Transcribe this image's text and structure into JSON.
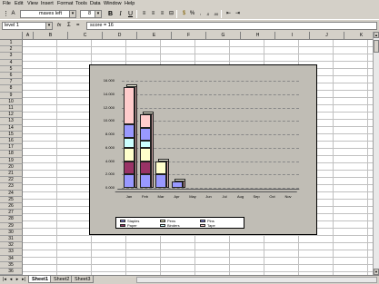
{
  "menu": [
    "File",
    "Edit",
    "View",
    "Insert",
    "Format",
    "Tools",
    "Data",
    "Window",
    "Help"
  ],
  "toolbar": {
    "font_name": "maves left",
    "font_size": "8",
    "bold": "B",
    "italic": "I",
    "underline": "U"
  },
  "formula_bar": {
    "name_box": "level 1",
    "fx": "fx",
    "sigma": "Σ",
    "equals": "=",
    "formula": "score = 16"
  },
  "columns": [
    "A",
    "B",
    "C",
    "D",
    "E",
    "F",
    "G",
    "H",
    "I",
    "J",
    "K"
  ],
  "rows": [
    "1",
    "2",
    "3",
    "4",
    "5",
    "6",
    "7",
    "8",
    "9",
    "10",
    "11",
    "12",
    "13",
    "14",
    "15",
    "16",
    "17",
    "18",
    "19",
    "20",
    "21",
    "22",
    "23",
    "24",
    "25",
    "26",
    "27",
    "28",
    "29",
    "30",
    "31",
    "32",
    "33",
    "34",
    "35",
    "36"
  ],
  "sheets": [
    "Sheet1",
    "Sheet2",
    "Sheet3"
  ],
  "active_sheet": 0,
  "chart_data": {
    "type": "bar",
    "stacked": true,
    "categories": [
      "Jan",
      "Feb",
      "Mar",
      "Apr",
      "May",
      "Jun",
      "Jul",
      "Aug",
      "Sep",
      "Oct",
      "Nov"
    ],
    "ylim": [
      0,
      16000
    ],
    "yticks": [
      "0.000",
      "2.000",
      "4.000",
      "6.000",
      "8.000",
      "10.000",
      "12.000",
      "14.000",
      "16.000"
    ],
    "series": [
      {
        "name": "Staples",
        "color": "#9999ff",
        "values": [
          2000,
          2000,
          2000,
          1000,
          0,
          0,
          0,
          0,
          0,
          0,
          0
        ]
      },
      {
        "name": "Paper",
        "color": "#993366",
        "values": [
          2000,
          2000,
          0,
          0,
          0,
          0,
          0,
          0,
          0,
          0,
          0
        ]
      },
      {
        "name": "Pens",
        "color": "#ffffcc",
        "values": [
          2000,
          2000,
          2000,
          0,
          0,
          0,
          0,
          0,
          0,
          0,
          0
        ]
      },
      {
        "name": "Binders",
        "color": "#ccffff",
        "values": [
          1500,
          1000,
          0,
          0,
          0,
          0,
          0,
          0,
          0,
          0,
          0
        ]
      },
      {
        "name": "Pins",
        "color": "#9999ff",
        "values": [
          2000,
          2000,
          0,
          0,
          0,
          0,
          0,
          0,
          0,
          0,
          0
        ]
      },
      {
        "name": "Tape",
        "color": "#ffcccc",
        "values": [
          5500,
          2000,
          0,
          0,
          0,
          0,
          0,
          0,
          0,
          0,
          0
        ]
      }
    ],
    "legend_position": "bottom"
  }
}
